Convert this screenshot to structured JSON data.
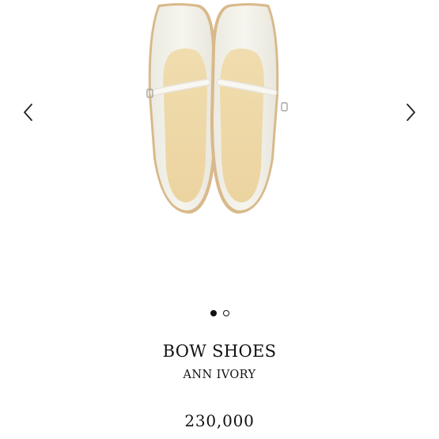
{
  "product": {
    "name": "BOW SHOES",
    "color_variant": "ANN IVORY",
    "price": "230,000"
  },
  "carousel": {
    "prev_icon": "chevron-left-icon",
    "next_icon": "chevron-right-icon",
    "slide_count": 2,
    "active_slide": 1
  },
  "colors": {
    "text": "#111111",
    "shoe_upper": "#f3f1e8",
    "insole": "#efd9ac",
    "sole": "#d9b98a"
  }
}
